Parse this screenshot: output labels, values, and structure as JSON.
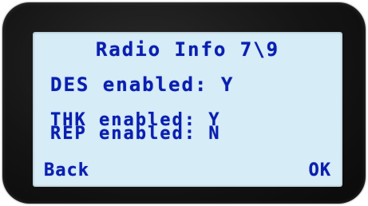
{
  "screen": {
    "title": "Radio Info 7\\9",
    "rows": [
      {
        "label": "DES enabled:",
        "value": "Y"
      },
      {
        "label": "THK enabled:",
        "value": "Y"
      },
      {
        "label": "REP enabled:",
        "value": "N"
      }
    ],
    "softkeys": {
      "left": "Back",
      "right": "OK"
    }
  },
  "colors": {
    "lcd_background": "#d6ecf6",
    "lcd_text": "#0a1fb0",
    "bezel": "#141414"
  }
}
